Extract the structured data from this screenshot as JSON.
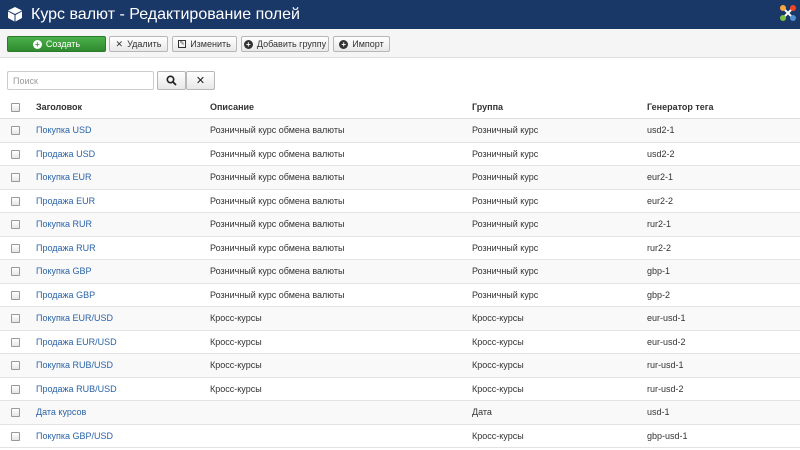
{
  "header": {
    "title": "Курс валют - Редактирование полей",
    "bg_color": "#1a3867"
  },
  "toolbar": {
    "create_label": "Создать",
    "delete_label": "Удалить",
    "edit_label": "Изменить",
    "add_group_label": "Добавить группу",
    "import_label": "Импорт"
  },
  "search": {
    "placeholder": "Поиск"
  },
  "table": {
    "columns": [
      "Заголовок",
      "Описание",
      "Группа",
      "Генератор тега"
    ],
    "rows": [
      {
        "title": "Покупка USD",
        "description": "Розничный курс обмена валюты",
        "group": "Розничный курс",
        "tag": "usd2-1"
      },
      {
        "title": "Продажа USD",
        "description": "Розничный курс обмена валюты",
        "group": "Розничный курс",
        "tag": "usd2-2"
      },
      {
        "title": "Покупка EUR",
        "description": "Розничный курс обмена валюты",
        "group": "Розничный курс",
        "tag": "eur2-1"
      },
      {
        "title": "Продажа EUR",
        "description": "Розничный курс обмена валюты",
        "group": "Розничный курс",
        "tag": "eur2-2"
      },
      {
        "title": "Покупка RUR",
        "description": "Розничный курс обмена валюты",
        "group": "Розничный курс",
        "tag": "rur2-1"
      },
      {
        "title": "Продажа RUR",
        "description": "Розничный курс обмена валюты",
        "group": "Розничный курс",
        "tag": "rur2-2"
      },
      {
        "title": "Покупка GBP",
        "description": "Розничный курс обмена валюты",
        "group": "Розничный курс",
        "tag": "gbp-1"
      },
      {
        "title": "Продажа GBP",
        "description": "Розничный курс обмена валюты",
        "group": "Розничный курс",
        "tag": "gbp-2"
      },
      {
        "title": "Покупка EUR/USD",
        "description": "Кросс-курсы",
        "group": "Кросс-курсы",
        "tag": "eur-usd-1"
      },
      {
        "title": "Продажа EUR/USD",
        "description": "Кросс-курсы",
        "group": "Кросс-курсы",
        "tag": "eur-usd-2"
      },
      {
        "title": "Покупка RUB/USD",
        "description": "Кросс-курсы",
        "group": "Кросс-курсы",
        "tag": "rur-usd-1"
      },
      {
        "title": "Продажа RUB/USD",
        "description": "Кросс-курсы",
        "group": "Кросс-курсы",
        "tag": "rur-usd-2"
      },
      {
        "title": "Дата курсов",
        "description": "",
        "group": "Дата",
        "tag": "usd-1"
      },
      {
        "title": "Покупка GBP/USD",
        "description": "",
        "group": "Кросс-курсы",
        "tag": "gbp-usd-1"
      }
    ]
  },
  "icons": {
    "header": "cube-icon",
    "brand": "joomla-logo-icon",
    "create": "plus-circle-icon",
    "delete": "x-icon",
    "edit": "edit-icon",
    "add_group": "plus-circle-icon",
    "import": "plus-circle-icon",
    "search": "search-icon",
    "clear": "close-icon"
  },
  "colors": {
    "link": "#2a63a8",
    "success": "#3a9a3a"
  }
}
